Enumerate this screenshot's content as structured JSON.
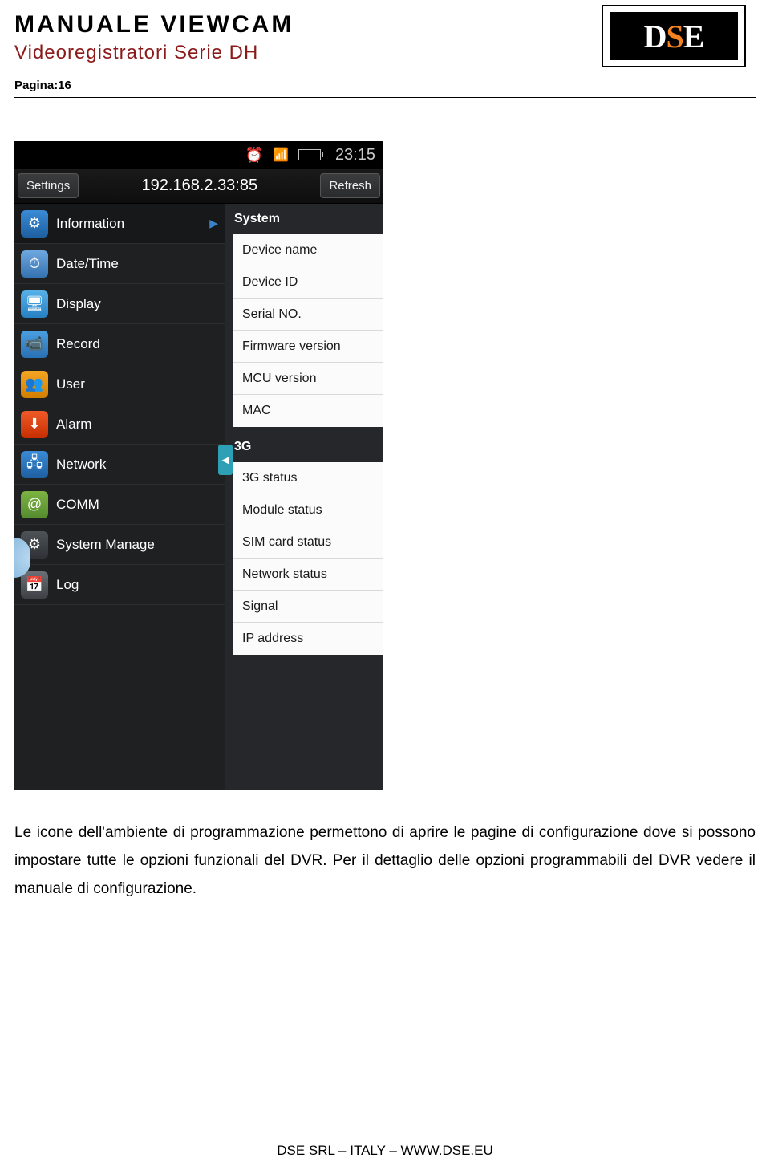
{
  "header": {
    "title": "MANUALE VIEWCAM",
    "subtitle": "Videoregistratori Serie DH",
    "pagina_label": "Pagina",
    "pagina_num": ":16"
  },
  "logo": {
    "d": "D",
    "s": "S",
    "e": "E"
  },
  "statusbar": {
    "time": "23:15"
  },
  "topbar": {
    "left": "Settings",
    "title": "192.168.2.33:85",
    "right": "Refresh"
  },
  "menu": [
    {
      "icon": "gear",
      "glyph": "⚙",
      "label": "Information",
      "active": true,
      "chev": true
    },
    {
      "icon": "clock",
      "glyph": "⏱",
      "label": "Date/Time"
    },
    {
      "icon": "display",
      "glyph": "🖥",
      "label": "Display"
    },
    {
      "icon": "record",
      "glyph": "📹",
      "label": "Record"
    },
    {
      "icon": "user",
      "glyph": "👥",
      "label": "User"
    },
    {
      "icon": "alarm",
      "glyph": "⬇",
      "label": "Alarm"
    },
    {
      "icon": "network",
      "glyph": "🖧",
      "label": "Network"
    },
    {
      "icon": "comm",
      "glyph": "@",
      "label": "COMM"
    },
    {
      "icon": "sysm",
      "glyph": "⚙",
      "label": "System Manage"
    },
    {
      "icon": "log",
      "glyph": "📅",
      "label": "Log"
    }
  ],
  "panel": {
    "section1": {
      "header": "System",
      "rows": [
        "Device name",
        "Device ID",
        "Serial NO.",
        "Firmware version",
        "MCU version",
        "MAC"
      ]
    },
    "section2": {
      "header": "3G",
      "rows": [
        "3G status",
        "Module status",
        "SIM card status",
        "Network status",
        "Signal",
        "IP address"
      ]
    },
    "knob": "◀"
  },
  "body_text": "Le icone dell'ambiente di programmazione permettono di aprire le pagine di configurazione dove si possono impostare tutte le opzioni funzionali del DVR. Per il dettaglio delle opzioni programmabili del DVR vedere il manuale di configurazione.",
  "footer": "DSE SRL – ITALY – WWW.DSE.EU"
}
